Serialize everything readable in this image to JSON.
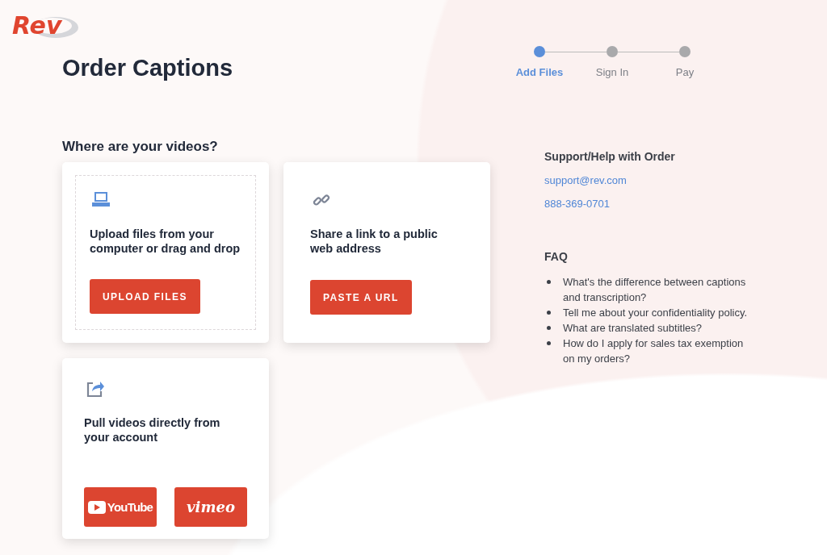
{
  "logo": {
    "text": "Rev"
  },
  "title": "Order Captions",
  "steps": [
    {
      "label": "Add Files",
      "selected": true
    },
    {
      "label": "Sign In",
      "selected": false
    },
    {
      "label": "Pay",
      "selected": false
    }
  ],
  "videos_heading": "Where are your videos?",
  "cards": [
    {
      "kind": "upload",
      "text": "Upload files from your computer or drag and drop",
      "buttons": [
        {
          "kind": "text",
          "label": "UPLOAD FILES"
        }
      ]
    },
    {
      "kind": "link",
      "text": "Share a link to a public web address",
      "buttons": [
        {
          "kind": "text",
          "label": "PASTE A URL"
        }
      ]
    },
    {
      "kind": "account",
      "text": "Pull videos directly from your account",
      "buttons": [
        {
          "kind": "youtube",
          "label": "YouTube"
        },
        {
          "kind": "vimeo",
          "label": "vimeo"
        }
      ]
    }
  ],
  "support": {
    "heading": "Support/Help with Order",
    "email": "support@rev.com",
    "phone": "888-369-0701"
  },
  "faq": {
    "heading": "FAQ",
    "items": [
      "What's the difference between captions and transcription?",
      "Tell me about your confidentiality policy.",
      "What are translated subtitles?",
      "How do I apply for sales tax exemption on my orders?"
    ]
  }
}
